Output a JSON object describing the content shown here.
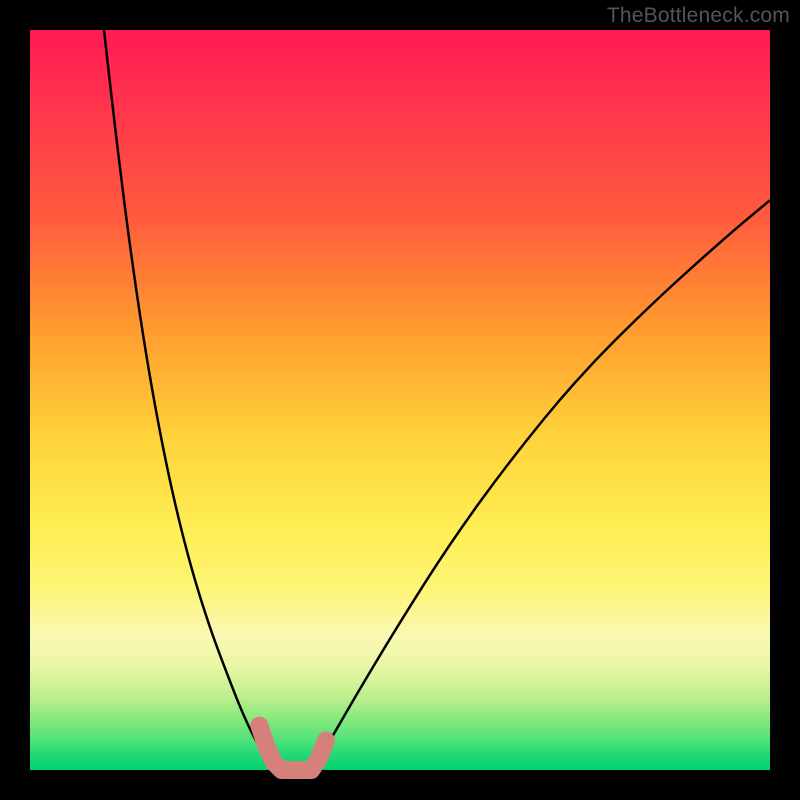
{
  "watermark": "TheBottleneck.com",
  "chart_data": {
    "type": "line",
    "title": "",
    "xlabel": "",
    "ylabel": "",
    "xlim": [
      0,
      100
    ],
    "ylim": [
      0,
      100
    ],
    "grid": false,
    "legend": false,
    "series": [
      {
        "name": "left-curve",
        "x": [
          10,
          12,
          15,
          18,
          21,
          24,
          27,
          29,
          31,
          32.5,
          34
        ],
        "y": [
          100,
          82,
          60,
          43,
          30,
          20,
          12,
          7,
          3,
          1,
          0
        ]
      },
      {
        "name": "right-curve",
        "x": [
          38,
          40,
          44,
          50,
          57,
          65,
          74,
          84,
          94,
          100
        ],
        "y": [
          0,
          3,
          10,
          20,
          31,
          42,
          53,
          63,
          72,
          77
        ]
      },
      {
        "name": "highlight-segment",
        "x": [
          31,
          32,
          33,
          34,
          36,
          38,
          39,
          40
        ],
        "y": [
          6,
          3,
          1,
          0,
          0,
          0,
          1.5,
          4
        ]
      }
    ],
    "colors": {
      "curve": "#000000",
      "highlight": "#d6807c"
    }
  }
}
